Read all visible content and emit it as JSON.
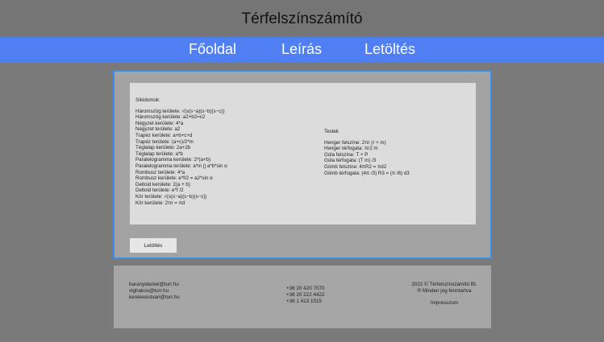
{
  "header": {
    "title": "Térfelszínszámító"
  },
  "nav": {
    "home": "Főoldal",
    "description": "Leírás",
    "download": "Letöltés"
  },
  "content": {
    "left_heading": "Síkidomok:",
    "left_items": [
      "Háromszög területe: √(s(s−a)(s−b)(s−c))",
      "Háromszög kerülete: a2+b2=c2",
      "Négyzet kerülete: 4*a",
      "Négyzet területe: a2",
      "Trapéz kerülete: a+b+c+d",
      "Trapéz területe: (a+c)/2*m",
      "Téglalap kerülete: 2a+2b",
      "Téglalap területe: a*b",
      "Paralelogramma kerülete: 2*(a+b)",
      "Paralelogramma területe: a*m || a*b*sin α",
      "Rombusz területe: 4*a",
      "Rombusz kerülete: e*f/2 = a2*sin α",
      "Deltoid kerülete: 2(a + b)",
      "Deltoid területe: e*f /2",
      "Kör területe: √(s(s−a)(s−b)(s−c))",
      "Kör kerülete: 2πr = πd"
    ],
    "right_heading": "Testek",
    "right_items": [
      "Henger felszíne: 2πr (r + m)",
      "Henger térfogata: πr2 m",
      "Gúla felszíne: T + P",
      "Gúla térfogata: (T m) /3",
      "Gömb felszíne: 4πR2 = πd2",
      "Gömb térfogata: (4π /3) R3 = (π /6) d3"
    ],
    "download_button": "Letöltés"
  },
  "footer": {
    "emails": [
      "baranyidaniel@turr.hu",
      "vighakos@turr.hu",
      "kerekesistvan@turr.hu"
    ],
    "phones": [
      "+36 20 420 7070",
      "+36 20 222 4422",
      "+36 1 413 1515"
    ],
    "copyright": "2022 © Térfelszínszámító Bt.",
    "rights": "® Minden jog fenntartva",
    "impressum": "Impresszum"
  }
}
